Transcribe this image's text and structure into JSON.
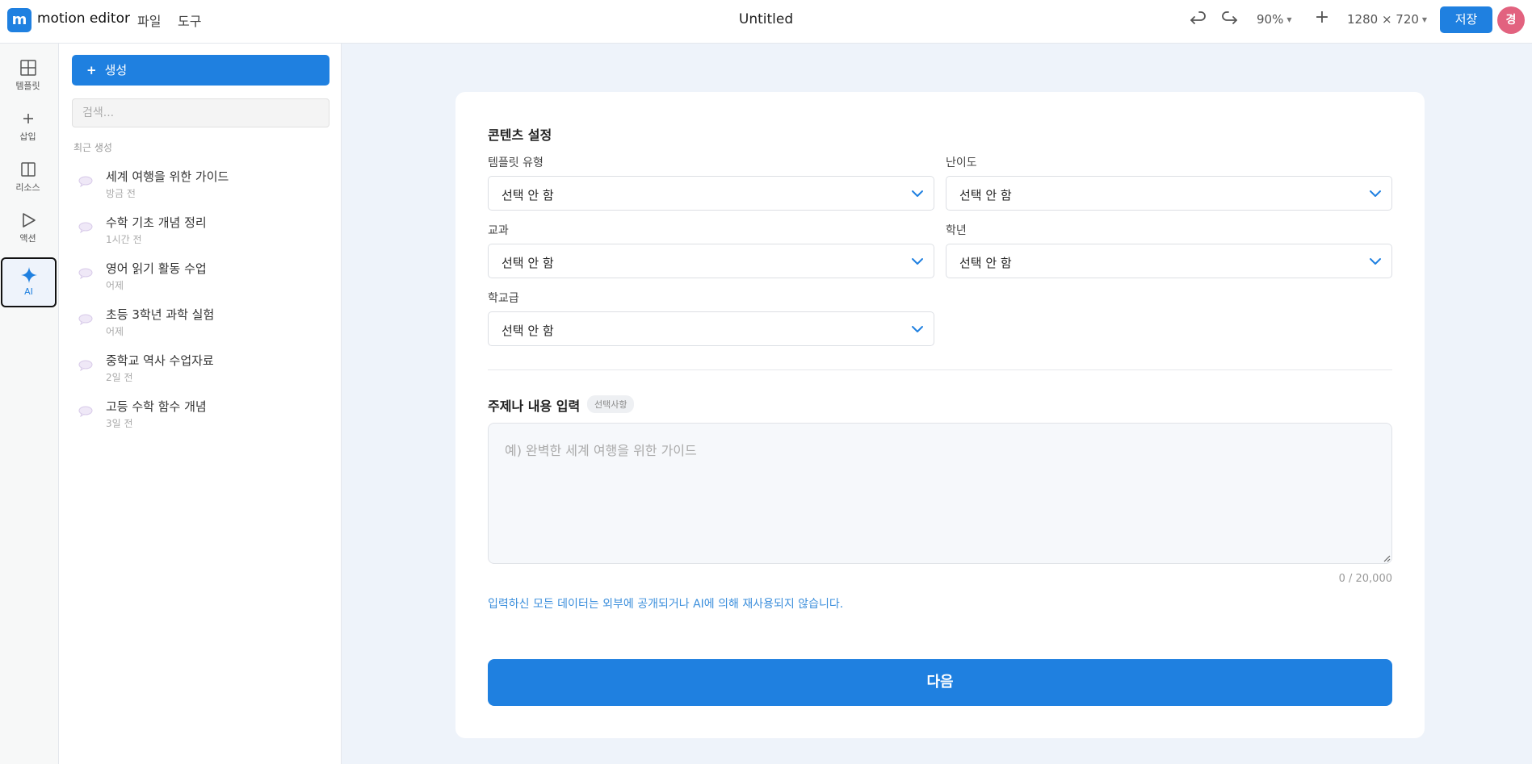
{
  "app": {
    "logo_letter": "m",
    "name": "motion editor",
    "menu": [
      "파일",
      "도구"
    ],
    "doc_title": "Untitled"
  },
  "toolbar": {
    "undo_icon": "undo-icon",
    "redo_icon": "redo-icon",
    "zoom": "90%",
    "add_label": "+",
    "canvas_size": "1280 × 720",
    "save_label": "저장",
    "avatar_initial": "경",
    "avatar_color": "#e2627f"
  },
  "rail": {
    "items": [
      {
        "label": "템플릿",
        "icon": "grid-icon"
      },
      {
        "label": "삽입",
        "icon": "plus-icon"
      },
      {
        "label": "리소스",
        "icon": "columns-icon"
      },
      {
        "label": "액션",
        "icon": "play-icon"
      },
      {
        "label": "AI",
        "icon": "sparkle-icon",
        "active": true
      }
    ]
  },
  "panel": {
    "create_label": "생성",
    "search_placeholder": "검색...",
    "recent_label": "최근 생성",
    "history": [
      {
        "title": "세계 여행을 위한 가이드",
        "time": "방금 전"
      },
      {
        "title": "수학 기초 개념 정리",
        "time": "1시간 전"
      },
      {
        "title": "영어 읽기 활동 수업",
        "time": "어제"
      },
      {
        "title": "초등 3학년 과학 실험",
        "time": "어제"
      },
      {
        "title": "중학교 역사 수업자료",
        "time": "2일 전"
      },
      {
        "title": "고등 수학 함수 개념",
        "time": "3일 전"
      }
    ]
  },
  "form": {
    "section_title": "콘텐츠 설정",
    "fields": {
      "template_type": {
        "label": "템플릿 유형",
        "value": "선택 안 함"
      },
      "difficulty": {
        "label": "난이도",
        "value": "선택 안 함"
      },
      "subject": {
        "label": "교과",
        "value": "선택 안 함"
      },
      "grade": {
        "label": "학년",
        "value": "선택 안 함"
      },
      "school_level": {
        "label": "학교급",
        "value": "선택 안 함"
      }
    },
    "topic_title": "주제나 내용 입력",
    "optional_badge": "선택사항",
    "topic_placeholder": "예) 완벽한 세계 여행을 위한 가이드",
    "counter": "0 / 20,000",
    "notice": "입력하신 모든 데이터는 외부에 공개되거나 AI에 의해 재사용되지 않습니다.",
    "next_label": "다음"
  },
  "colors": {
    "accent": "#1f80e0",
    "background": "#eef3fa",
    "notice_text": "#3c8fdc"
  }
}
